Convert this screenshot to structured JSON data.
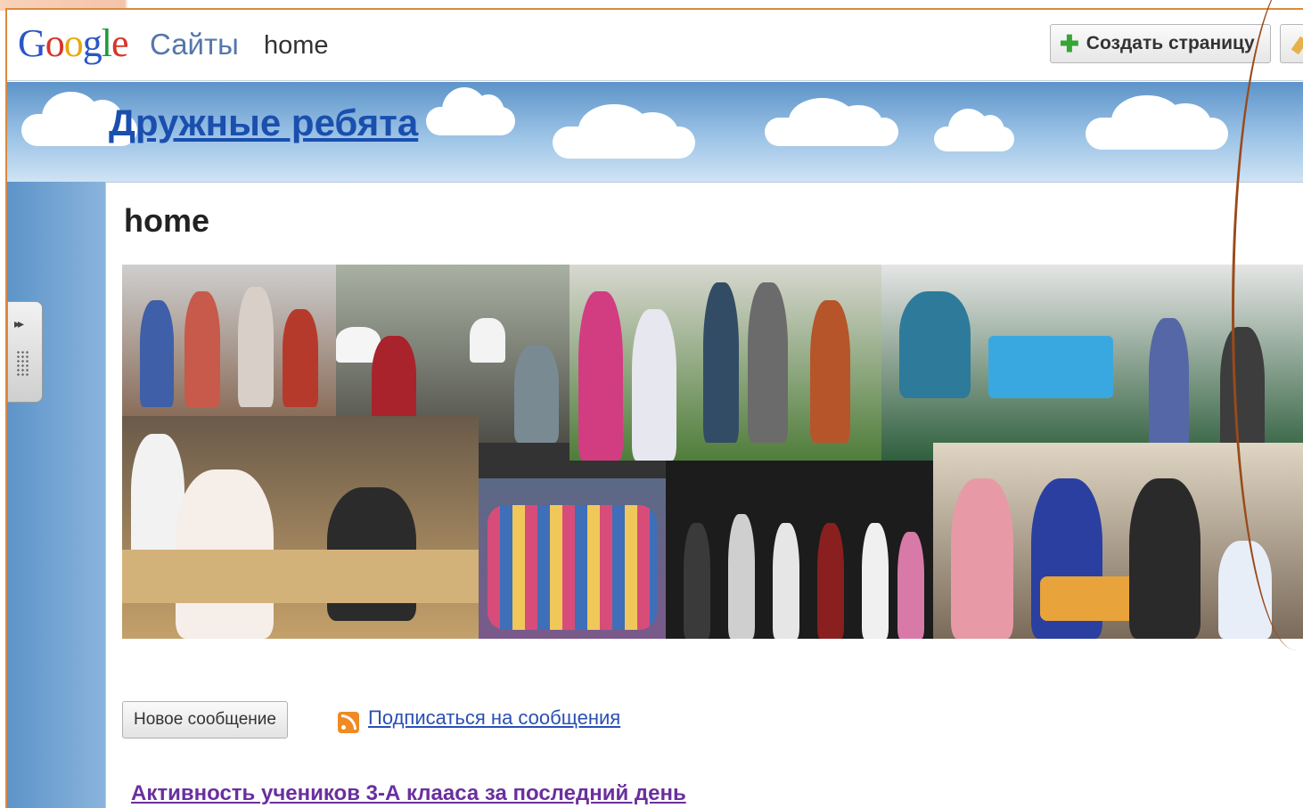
{
  "header": {
    "logo_text": "Google",
    "product_name": "Сайты",
    "site_page": "home",
    "create_page_label": "Создать страницу"
  },
  "banner": {
    "site_title": "Дружные ребята"
  },
  "main": {
    "page_title": "home",
    "new_post_label": "Новое сообщение",
    "subscribe_label": "Подписаться на сообщения",
    "activity_link": "Активность учеников 3-А клааса за последний день"
  },
  "colors": {
    "accent_orange": "#d98a3e",
    "sky_blue": "#5d94c9",
    "link_blue": "#2a4fb5",
    "visited_purple": "#6a2f9e"
  },
  "icons": {
    "add": "plus-icon",
    "edit": "pencil-icon",
    "rss": "rss-icon",
    "sidebar_toggle": "double-arrow-icon"
  }
}
